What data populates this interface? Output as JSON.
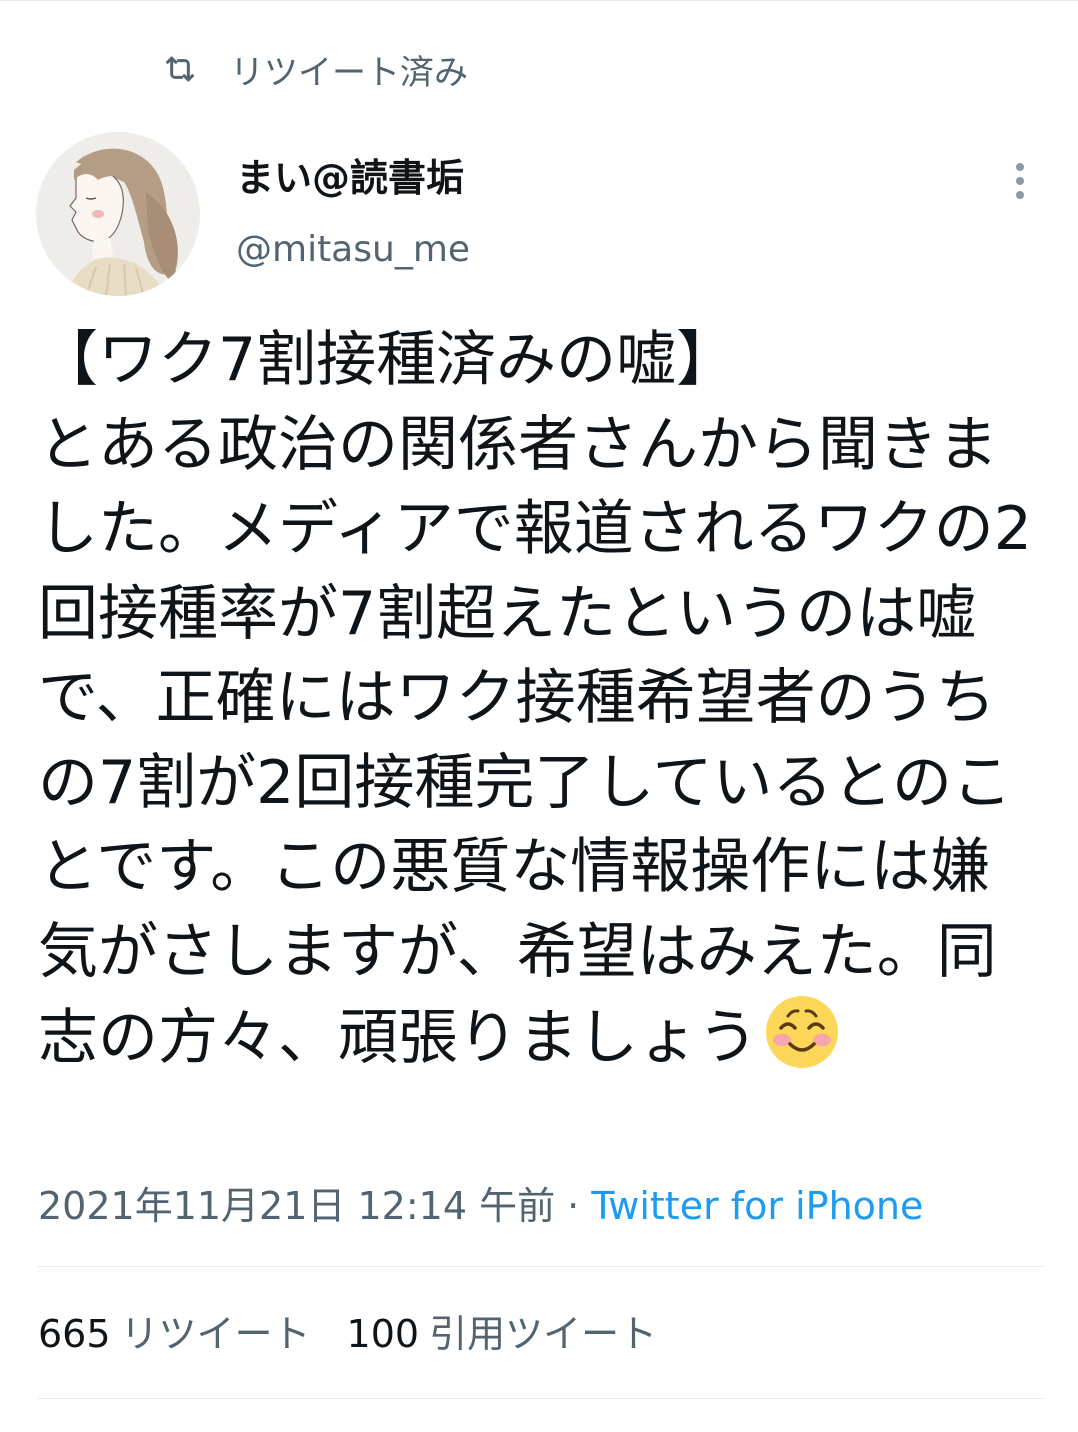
{
  "retweet_banner": {
    "label": "リツイート済み"
  },
  "author": {
    "display_name": "まい@読書垢",
    "handle": "@mitasu_me"
  },
  "tweet": {
    "text_before_emoji": "【ワク7割接種済みの嘘】\nとある政治の関係者さんから聞きました。メディアで報道されるワクの2回接種率が7割超えたというのは嘘で、正確にはワク接種希望者のうちの7割が2回接種完了しているとのことです。この悪質な情報操作には嫌気がさしますが、希望はみえた。同志の方々、頑張りましょう",
    "emoji": "smiling-face-with-blush-emoji"
  },
  "meta": {
    "timestamp": "2021年11月21日 12:14 午前",
    "separator": " · ",
    "source": "Twitter for iPhone"
  },
  "stats": {
    "retweets_count": "665",
    "retweets_label": "リツイート",
    "quotes_count": "100",
    "quotes_label": "引用ツイート"
  },
  "colors": {
    "text_primary": "#0f1419",
    "text_secondary": "#536471",
    "link": "#1d9bf0",
    "divider": "#e6ecf0"
  }
}
